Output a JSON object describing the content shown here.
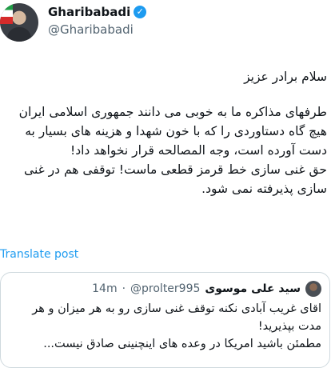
{
  "author": {
    "display_name": "Gharibabadi",
    "handle": "@Gharibabadi",
    "verified_icon": "verified-badge-icon"
  },
  "tweet": {
    "greeting": "سلام برادر عزیز",
    "paragraph1": "طرفهای مذاکره ما به خوبی می دانند جمهوری اسلامی ایران هیچ گاه دستاوردی را که با خون شهدا و هزینه های بسیار به دست آورده است، وجه المصالحه قرار نخواهد داد!",
    "paragraph2": "حق غنی سازی خط قرمز قطعی ماست! توقفی هم در غنی سازی پذیرفته نمی شود."
  },
  "translate_label": "Translate post",
  "quote": {
    "name": "سید علی موسوی",
    "handle": "@prolter995",
    "dot": "·",
    "time": "14m",
    "text_line1": "اقای غریب آبادی نکنه توقف غنی سازی رو به هر میزان و هر مدت بپذیرید!",
    "text_line2": "مطمئن باشید امریکا در وعده های اینچنینی صادق نیست..."
  }
}
